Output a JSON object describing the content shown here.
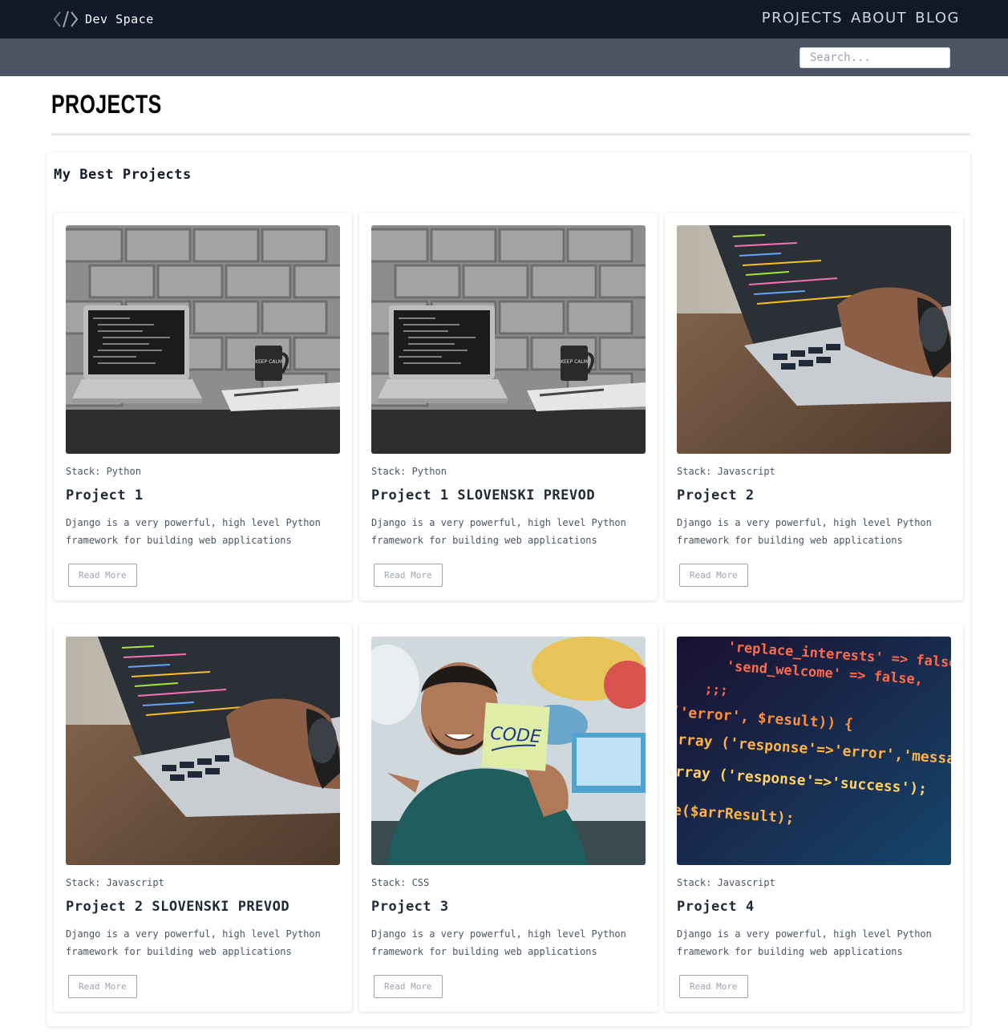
{
  "brand": {
    "name": "Dev Space",
    "icon": "code-brackets-icon"
  },
  "nav": {
    "items": [
      "PROJECTS",
      "ABOUT",
      "BLOG"
    ]
  },
  "search": {
    "placeholder": "Search...",
    "value": ""
  },
  "page": {
    "title": "PROJECTS"
  },
  "section": {
    "heading": "My Best Projects"
  },
  "cards": [
    {
      "stack": "Stack: Python",
      "title": "Project 1",
      "description": "Django is a very powerful, high level Python framework for building web applications",
      "button": "Read More",
      "image": "laptop-brick-wall-image"
    },
    {
      "stack": "Stack: Python",
      "title": "Project 1 SLOVENSKI PREVOD",
      "description": "Django is a very powerful, high level Python framework for building web applications",
      "button": "Read More",
      "image": "laptop-brick-wall-image"
    },
    {
      "stack": "Stack: Javascript",
      "title": "Project 2",
      "description": "Django is a very powerful, high level Python framework for building web applications",
      "button": "Read More",
      "image": "hand-typing-laptop-image"
    },
    {
      "stack": "Stack: Javascript",
      "title": "Project 2 SLOVENSKI PREVOD",
      "description": "Django is a very powerful, high level Python framework for building web applications",
      "button": "Read More",
      "image": "hand-typing-laptop-image"
    },
    {
      "stack": "Stack: CSS",
      "title": "Project 3",
      "description": "Django is a very powerful, high level Python framework for building web applications",
      "button": "Read More",
      "image": "man-holding-code-note-image"
    },
    {
      "stack": "Stack: Javascript",
      "title": "Project 4",
      "description": "Django is a very powerful, high level Python framework for building web applications",
      "button": "Read More",
      "image": "code-screen-closeup-image"
    }
  ],
  "image_text": {
    "mug": "KEEP CALM",
    "note": "CODE",
    "code_lines": [
      "'replace_interests' => false,",
      "'send_welcome'      => false,",
      "('error', $result)) {",
      "array ('response'=>'error','messa",
      "array ('response'=>'success');",
      "de($arrResult);"
    ]
  },
  "colors": {
    "navbar": "#111827",
    "searchbar": "#4b5563",
    "accent": "#f59e0b"
  }
}
